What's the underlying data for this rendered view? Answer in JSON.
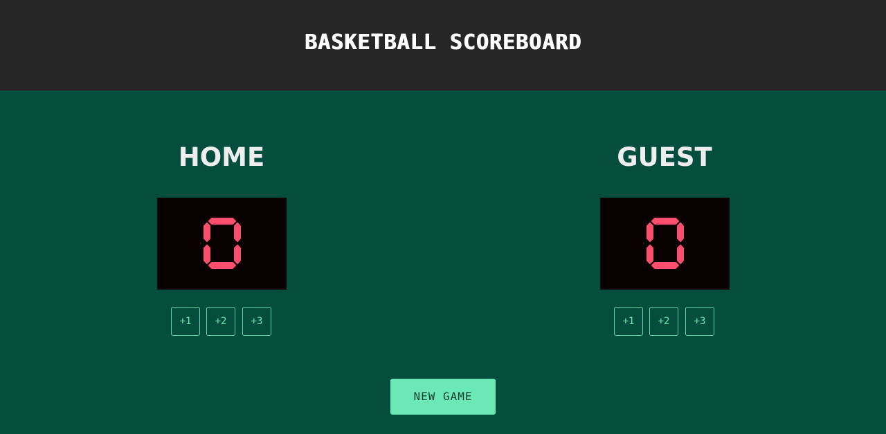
{
  "header": {
    "title": "BASKETBALL SCOREBOARD"
  },
  "home": {
    "name": "HOME",
    "score": "0",
    "buttons": [
      "+1",
      "+2",
      "+3"
    ]
  },
  "guest": {
    "name": "GUEST",
    "score": "0",
    "buttons": [
      "+1",
      "+2",
      "+3"
    ]
  },
  "actions": {
    "new_game_label": "NEW GAME"
  },
  "colors": {
    "background": "#054d3c",
    "header": "#262626",
    "score_box": "#080001",
    "score_digit": "#f94f6d",
    "accent": "#6ce8b6"
  }
}
